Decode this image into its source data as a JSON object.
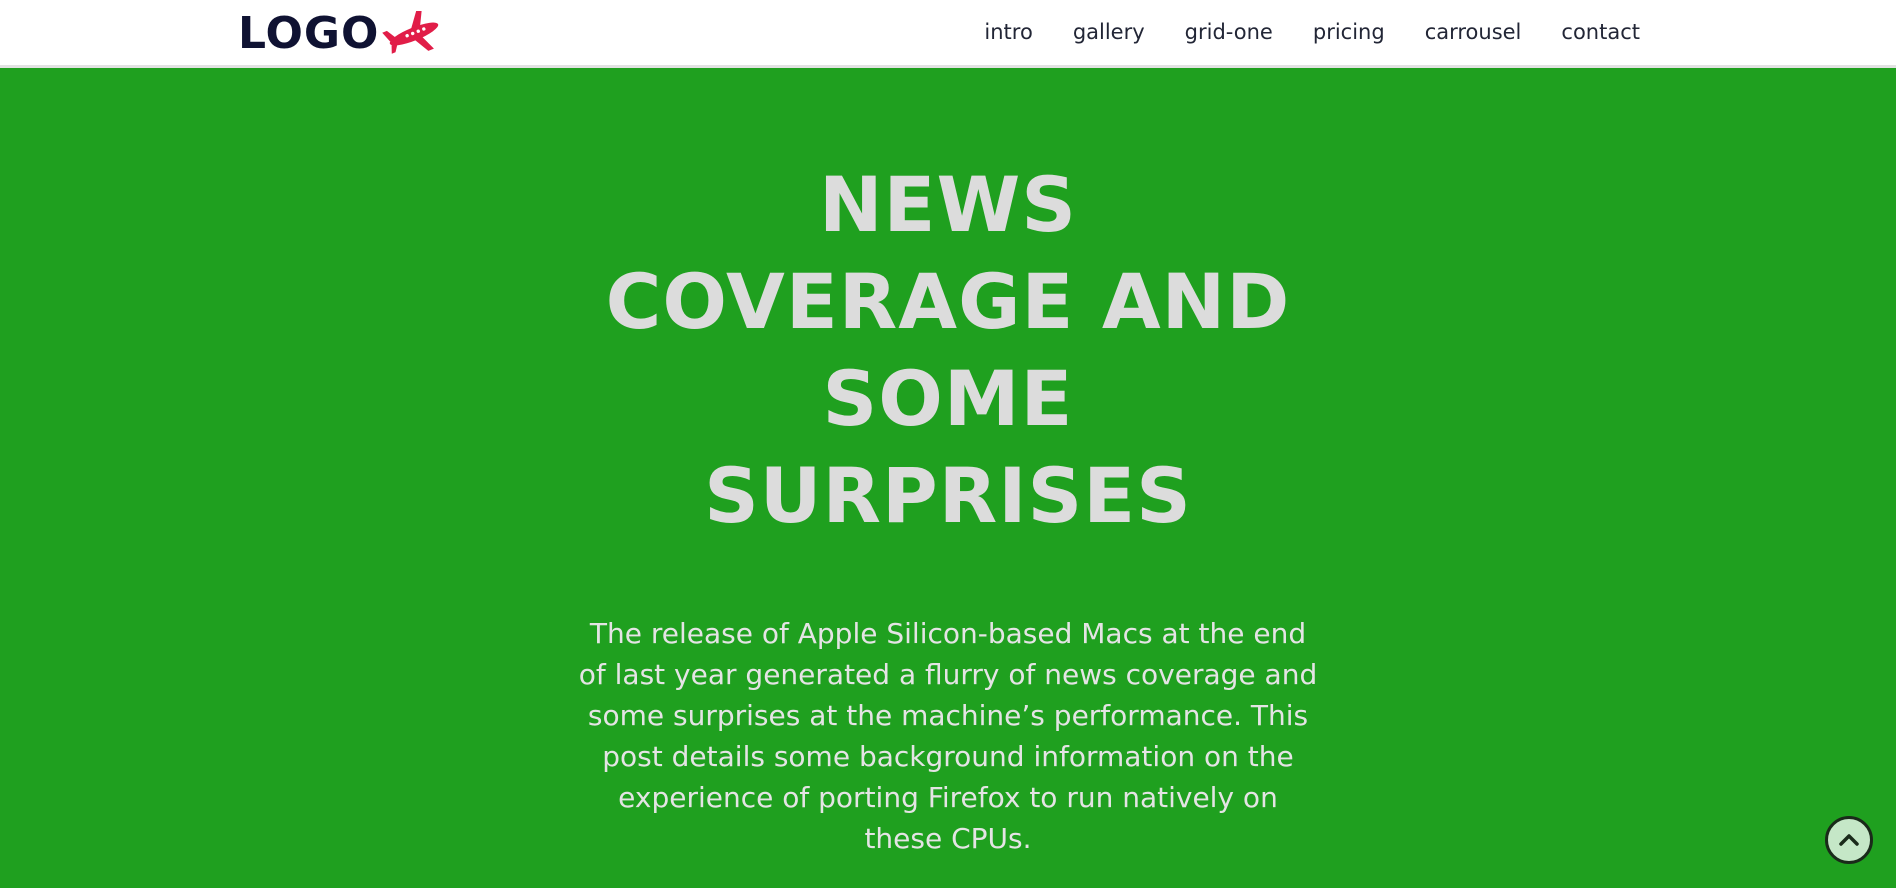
{
  "brand": {
    "logo_text": "LOGO",
    "logo_icon": "airplane-icon",
    "logo_color": "#0f1232",
    "icon_color": "#e11d48"
  },
  "nav": {
    "items": [
      {
        "label": "intro"
      },
      {
        "label": "gallery"
      },
      {
        "label": "grid-one"
      },
      {
        "label": "pricing"
      },
      {
        "label": "carrousel"
      },
      {
        "label": "contact"
      }
    ]
  },
  "hero": {
    "background": "#1fa01f",
    "title_lines": [
      "NEWS",
      "COVERAGE AND",
      "SOME",
      "SURPRISES"
    ],
    "paragraph_lines": [
      "The release of Apple Silicon-based Macs at the end",
      "of last year generated a flurry of news coverage and",
      "some surprises at the machine’s performance. This",
      "post details some background information on the",
      "experience of porting Firefox to run natively on",
      "these CPUs."
    ]
  },
  "back_to_top": {
    "icon": "chevron-up-icon"
  }
}
